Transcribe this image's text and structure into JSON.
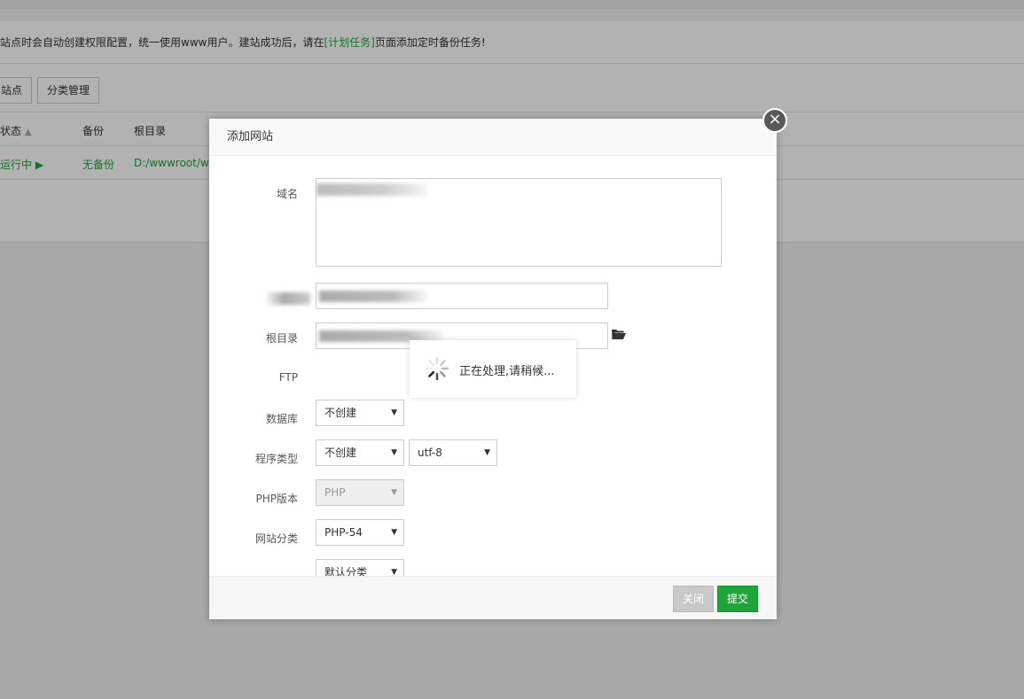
{
  "background": {
    "notice_text": "站点时会自动创建权限配置，统一使用www用户。建站成功后，请在",
    "notice_link": "[计划任务]",
    "notice_tail": "页面添加定时备份任务!",
    "buttons": {
      "add_site_partial": "站点",
      "category_manage": "分类管理"
    },
    "table": {
      "headers": {
        "status": "状态",
        "backup": "备份",
        "root": "根目录"
      },
      "row": {
        "status": "运行中 ▶",
        "backup": "无备份",
        "root": "D:/wwwroot/w"
      }
    }
  },
  "modal": {
    "title": "添加网站",
    "close_symbol": "×",
    "fields": {
      "domain_label": "域名",
      "root_label": "根目录",
      "ftp_label": "FTP",
      "ftp_value": "不创建",
      "db_label": "数据库",
      "db_value": "不创建",
      "db_charset": "utf-8",
      "program_label": "程序类型",
      "program_value": "PHP",
      "php_label": "PHP版本",
      "php_value": "PHP-54",
      "category_label": "网站分类",
      "category_value": "默认分类"
    },
    "footer": {
      "close_label": "关闭",
      "submit_label": "提交"
    }
  },
  "loading": {
    "text": "正在处理,请稍候..."
  },
  "colors": {
    "accent": "#20a53a",
    "overlay": "rgba(0,0,0,0.30)"
  }
}
